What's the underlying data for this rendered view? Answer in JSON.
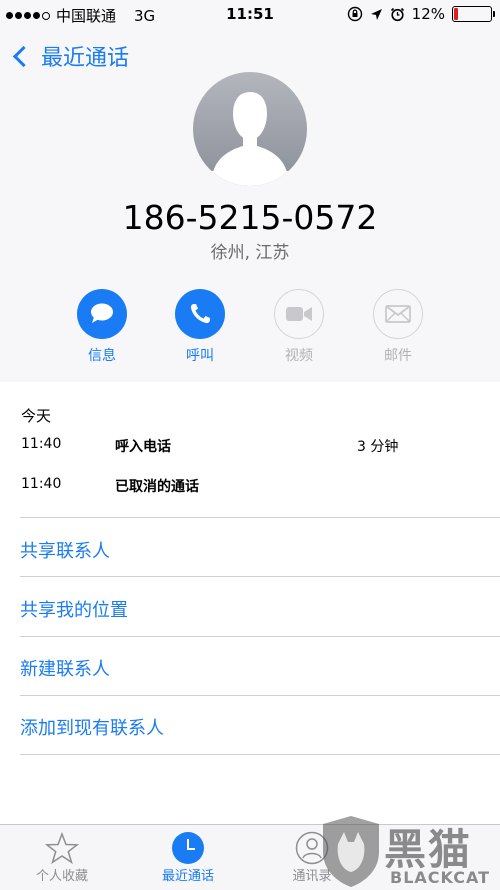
{
  "status_bar": {
    "carrier": "中国联通",
    "network": "3G",
    "time": "11:51",
    "battery_percent": "12%",
    "battery_level": 0.12,
    "icons": [
      "signal-dots-icon",
      "rotation-lock-icon",
      "location-arrow-icon",
      "alarm-icon",
      "battery-icon"
    ]
  },
  "nav": {
    "back_label": "最近通话"
  },
  "contact": {
    "phone": "186-5215-0572",
    "location": "徐州, 江苏"
  },
  "actions": [
    {
      "label": "信息",
      "icon": "message-icon",
      "enabled": true
    },
    {
      "label": "呼叫",
      "icon": "phone-icon",
      "enabled": true
    },
    {
      "label": "视频",
      "icon": "video-icon",
      "enabled": false
    },
    {
      "label": "邮件",
      "icon": "mail-icon",
      "enabled": false
    }
  ],
  "history": {
    "day": "今天",
    "calls": [
      {
        "time": "11:40",
        "type": "呼入电话",
        "duration": "3 分钟"
      },
      {
        "time": "11:40",
        "type": "已取消的通话",
        "duration": ""
      }
    ]
  },
  "options": [
    "共享联系人",
    "共享我的位置",
    "新建联系人",
    "添加到现有联系人"
  ],
  "tabs": [
    {
      "label": "个人收藏",
      "icon": "star-icon",
      "active": false
    },
    {
      "label": "最近通话",
      "icon": "clock-icon",
      "active": true
    },
    {
      "label": "通讯录",
      "icon": "contacts-icon",
      "active": false
    }
  ],
  "watermark": {
    "brand_cn": "黑猫",
    "brand_en": "BLACKCAT"
  },
  "colors": {
    "accent": "#1a7cf5",
    "battery_low": "#e02020",
    "disabled": "#b2b2b6"
  }
}
